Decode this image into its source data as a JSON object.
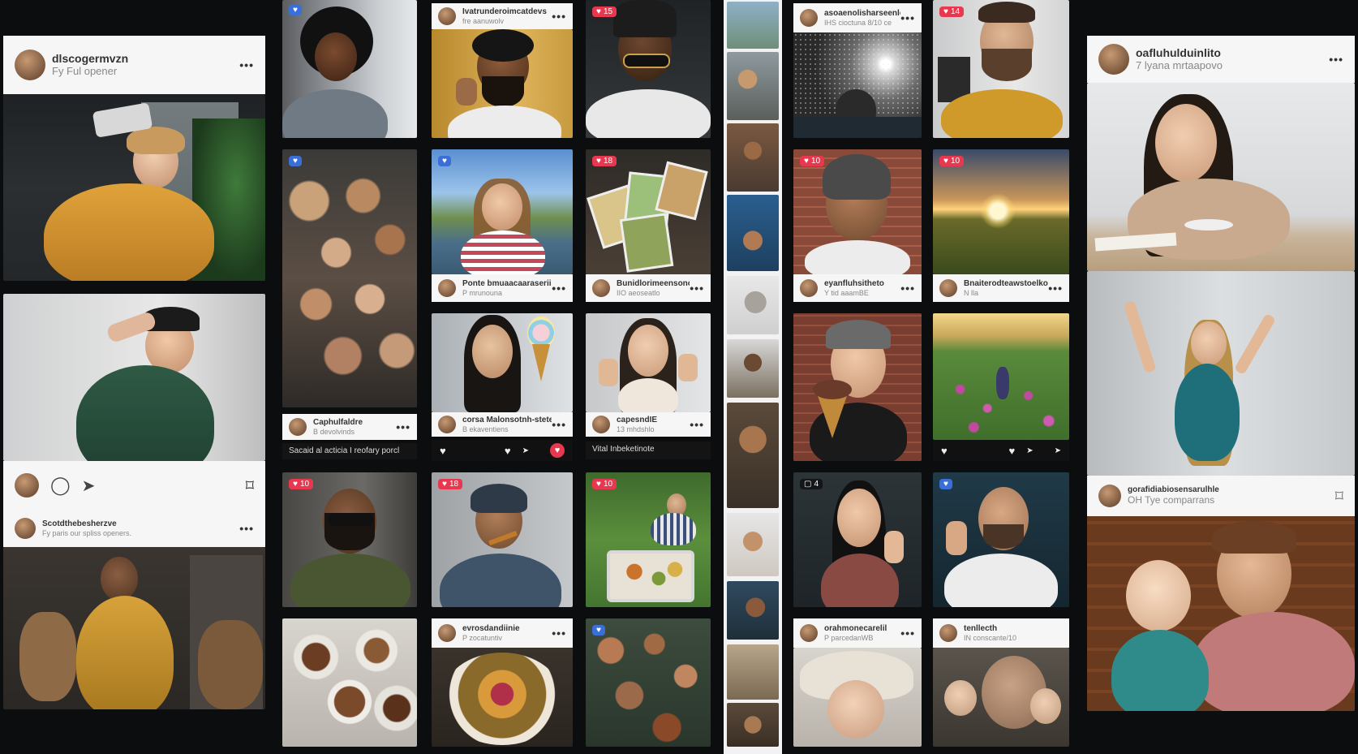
{
  "col1": {
    "card1": {
      "username": "dlscogermvzn",
      "sub": "Fy Ful opener"
    },
    "card2": {
      "username": "Scotdthebesherzve",
      "sub": "Fy paris our spliss openers."
    }
  },
  "col2": {
    "card1": {
      "username": "Caphulfaldre",
      "sub": "B devolvinds",
      "caption": "Sacaid al acticia I reofary porcl"
    }
  },
  "col3": {
    "card1": {
      "username": "Ivatrunderoimcatdevs",
      "sub": "fre aanuwolv"
    },
    "card2": {
      "username": "Ponte bmuaacaaraseriis",
      "sub": "P mrunouna"
    },
    "card3": {
      "username": "corsa Malonsotnh-stete",
      "sub": "B ekaventiens"
    },
    "card4": {
      "username": "evrosdandiinie",
      "sub": "P zocatuntiv"
    }
  },
  "col4": {
    "card1": {
      "username": "Bunidlorimeensonolit",
      "sub": "IIO aeoseatlo"
    },
    "card2": {
      "username": "capesndIE",
      "sub": "13 mhdshlo",
      "caption": "Vital Inbeketinote"
    }
  },
  "col6": {
    "card1": {
      "username": "asoaenolisharseenlo",
      "sub": "IHS cioctuna 8/10 ce"
    },
    "card2": {
      "username": "eyanfluhsitheto",
      "sub": "Y tid aaamBE"
    },
    "badge": "4",
    "card3": {
      "username": "orahmonecarelil",
      "sub": "P parcedanWB"
    }
  },
  "col7": {
    "card1": {
      "username": "Bnaiterodteawstoelko",
      "sub": "N lla"
    },
    "card2": {
      "username": "tenllecth",
      "sub": "IN conscante/10"
    }
  },
  "col8": {
    "card1": {
      "username": "oafluhulduinlito",
      "sub": "7 lyana mrtaapovo"
    },
    "card2": {
      "username": "gorafidiabiosensarulhle",
      "sub": "OH Tye comparrans"
    }
  },
  "badges": [
    "10",
    "18",
    "15",
    "18",
    "10",
    "10",
    "14",
    "10"
  ],
  "icons": {
    "heart": "♥",
    "comment": "◯",
    "share": "➤",
    "bookmark": "⌑",
    "more": "•••"
  }
}
